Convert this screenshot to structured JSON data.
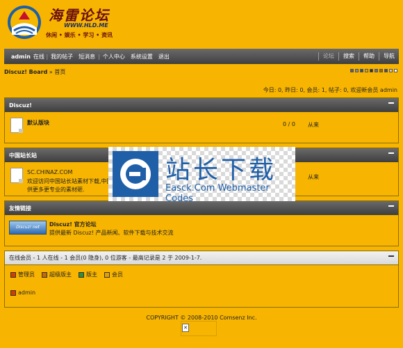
{
  "logo": {
    "title": "海雷论坛",
    "url": "WWW.HLD.ME",
    "slogan": "休闲 • 娱乐 • 学习 • 资讯"
  },
  "nav": {
    "user": "admin",
    "status": "在线",
    "left_items": [
      "我的帖子",
      "短消息",
      "个人中心",
      "系统设置",
      "退出"
    ],
    "right_items": [
      "论坛",
      "搜索",
      "帮助",
      "导航"
    ]
  },
  "breadcrumb": {
    "board": "Discuz! Board",
    "sep": "»",
    "home": "首页"
  },
  "style_swatches": [
    "#5d5d5d",
    "#8c8c8c",
    "#2c4c7c",
    "#e8a800",
    "#2e2e2e",
    "#6f6f6f",
    "#9a6b00",
    "#4a4a4a",
    "#c8c8c8",
    "#ffffff"
  ],
  "stats": "今日: 0, 昨日: 0, 会员: 1, 帖子: 0, 欢迎新会员 admin",
  "categories": [
    {
      "title": "Discuz!",
      "forums": [
        {
          "name": "默认版块",
          "desc": "",
          "count": "0 / 0",
          "last": "从来"
        }
      ]
    },
    {
      "title": "中国站长站",
      "forums": [
        {
          "name": "SC.CHINAZ.COM",
          "desc": "欢迎访问中国站长站素材下载,中国站长",
          "desc2": "供更多更专业的素材砸.",
          "count": "",
          "last": "从来"
        }
      ]
    }
  ],
  "links": {
    "title": "友情链接",
    "logo_text": "Discuz! net",
    "name": "Discuz! 官方论坛",
    "desc": "提供最新 Discuz! 产品新闻、软件下载与技术交流"
  },
  "online": {
    "summary": "在线会员 - 1 人在线 - 1 会员(0 隐身), 0 位游客 - 最高记录是 2 于 2009-1-7.",
    "legend": [
      {
        "label": "管理员",
        "color": "#d83a00"
      },
      {
        "label": "超级版主",
        "color": "#c46a00"
      },
      {
        "label": "版主",
        "color": "#2f8f3a"
      },
      {
        "label": "会员",
        "color": "#e0a000"
      }
    ],
    "users": [
      "admin"
    ]
  },
  "footer": {
    "copyright": "COPYRIGHT © 2008-2010 Comsenz Inc."
  },
  "watermark": {
    "cn": "站长下载",
    "en": "Easck.Com Webmaster Codes"
  }
}
